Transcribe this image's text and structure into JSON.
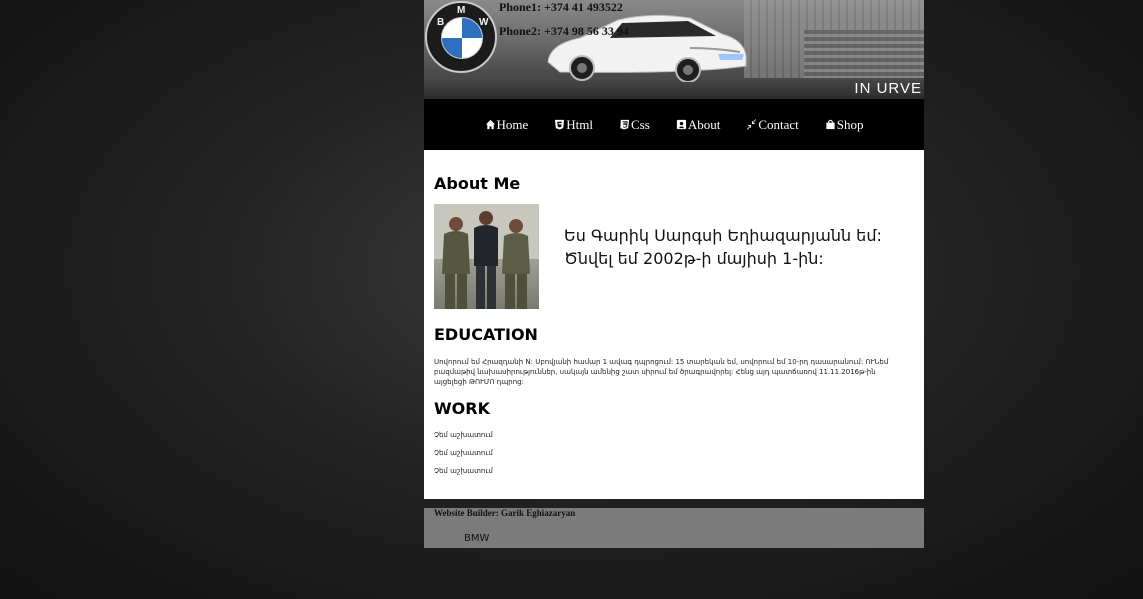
{
  "header": {
    "phones": [
      "Phone1: +374 41 493522",
      "Phone2: +374 98 56 33 94"
    ],
    "logo_letters": [
      "B",
      "M",
      "W"
    ],
    "watermark": "IN URVE"
  },
  "nav": {
    "items": [
      {
        "label": "Home",
        "icon": "home-icon"
      },
      {
        "label": "Html",
        "icon": "html5-icon"
      },
      {
        "label": "Css",
        "icon": "css3-icon"
      },
      {
        "label": "About",
        "icon": "id-card-icon"
      },
      {
        "label": "Contact",
        "icon": "compress-icon"
      },
      {
        "label": "Shop",
        "icon": "shopping-bag-icon"
      }
    ]
  },
  "about": {
    "heading": "About Me",
    "intro": "Ես Գարիկ Սարգսի Եղիազարյանն եմ: Ծնվել եմ 2002թ-ի մայիսի 1-ին:"
  },
  "education": {
    "heading": "EDUCATION",
    "text": "Սովորում եմ Հրազդանի N: Սբովյանի համար 1 ավագ դպրոցում: 15 տարեկան եմ, սովորում եմ 10-րդ դասարանում: ՈՒՆեմ բազմաթիվ նախասիրություններ, սակայն ամենից շատ սիրում եմ ծրագրավորել: Հենց այդ պատճառով 11.11.2016թ-ին այցելեցի ԹՈՒՄՈ դպրոց:"
  },
  "work": {
    "heading": "WORK",
    "items": [
      "Չեմ աշխատում",
      "Չեմ աշխատում",
      "Չեմ աշխատում"
    ]
  },
  "footer": {
    "credit": "Website Builder: Garik Eghiazaryan",
    "brand": "BMW"
  },
  "colors": {
    "nav_bg": "#000000",
    "footer_bg": "#7b7b7b",
    "content_bg": "#ffffff",
    "bmw_blue": "#2e6fbf"
  }
}
